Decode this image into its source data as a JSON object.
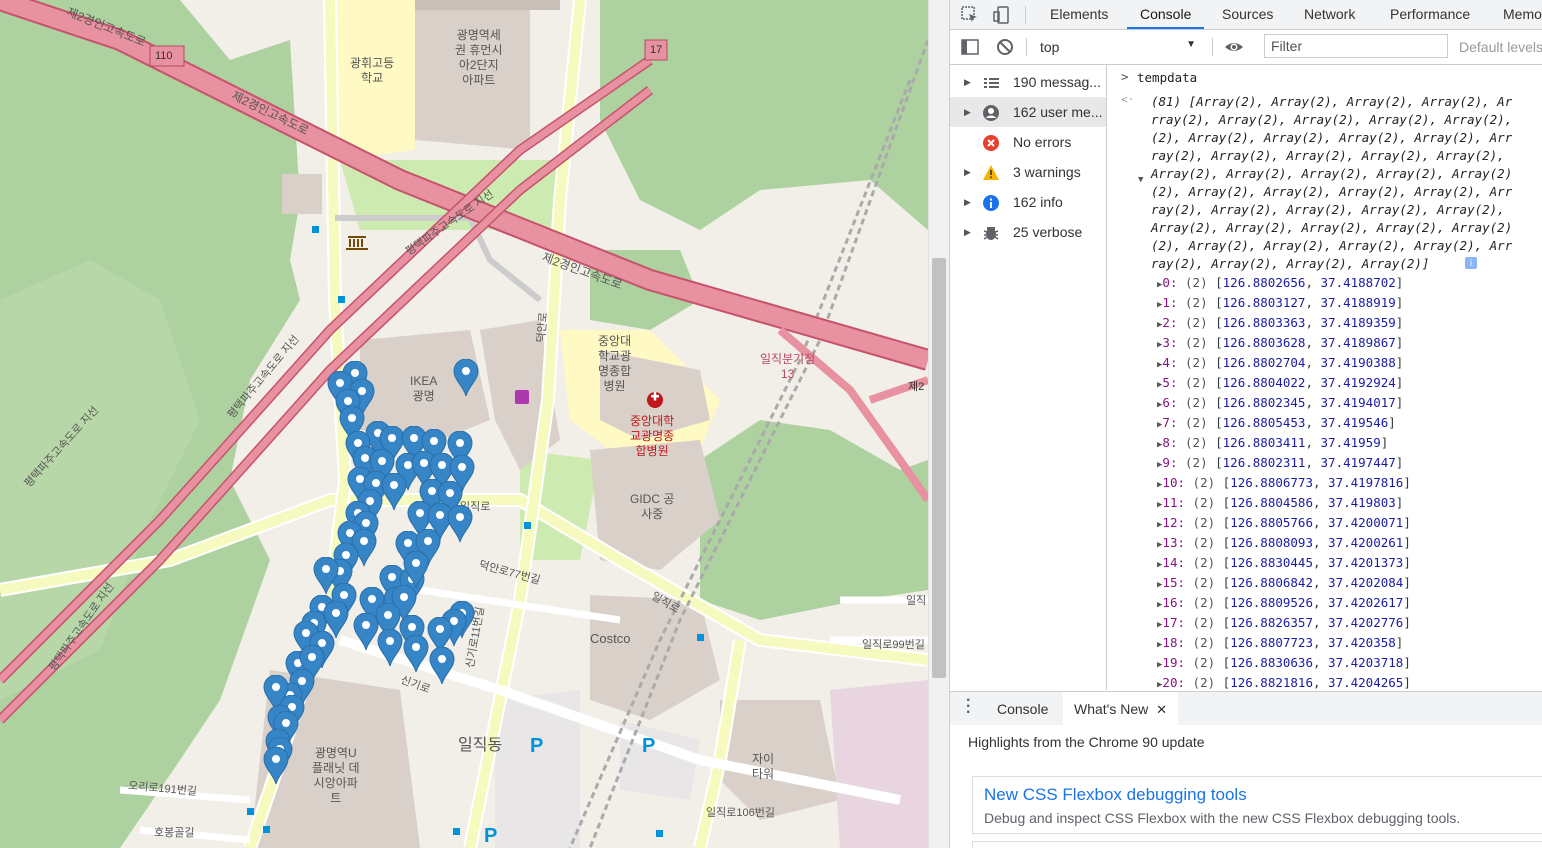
{
  "map": {
    "labels": {
      "school": "광휘고등\n학교",
      "apartment_north": "광명역세\n권 휴먼시\n아2단지\n아파트",
      "ikea": "IKEA\n광명",
      "hospital_name": "중앙대\n학교광\n명종합\n병원",
      "hospital_red": "중앙대학\n교광명종\n합병원",
      "gidc": "GIDC 공\n사중",
      "costco": "Costco",
      "iljik_dong": "일직동",
      "planet_apt": "광명역U\n플래닛 데\n시앙아파\n트",
      "xi_tower": "자이\n타워",
      "expressway_1": "제2경인고속도로",
      "expressway_2": "제2경인고속도로",
      "expressway_3": "제2경인고속도로",
      "branch_1": "평택파주고속도로 지선",
      "branch_2": "평택파주고속도로 지선",
      "branch_3": "평택파주고속도로 지선",
      "branch_4": "평택파주고속도로 지선",
      "junction": "일직분기점\n13",
      "ilijk_ro": "일직로",
      "ilijk_ro_2": "일직로",
      "ilijk_ro_99": "일직로99번길",
      "ilijk_ro_106": "일직로106번길",
      "ilijk_ro_right": "일직",
      "deogan_ro": "덕안로",
      "deogan_ro_77": "덕안로77번길",
      "sinki_ro": "신기로",
      "sinki_ro_11": "신기로11번길",
      "orori_191": "오리로191번길",
      "hobong": "호봉골길",
      "route_110": "110",
      "route_17": "17",
      "right_edge": "제2"
    },
    "marker_color": "#3585c7"
  },
  "devtools": {
    "tabs": [
      "Elements",
      "Console",
      "Sources",
      "Network",
      "Performance",
      "Memo"
    ],
    "active_tab": "Console",
    "context": "top",
    "filter_placeholder": "Filter",
    "level": "Default levels",
    "sidebar": [
      {
        "label": "190 messag...",
        "icon": "list-icon",
        "expandable": true
      },
      {
        "label": "162 user me...",
        "icon": "user-icon",
        "expandable": true
      },
      {
        "label": "No errors",
        "icon": "error-icon",
        "expandable": false
      },
      {
        "label": "3 warnings",
        "icon": "warning-icon",
        "expandable": true
      },
      {
        "label": "162 info",
        "icon": "info-icon",
        "expandable": true
      },
      {
        "label": "25 verbose",
        "icon": "bug-icon",
        "expandable": true
      }
    ],
    "console": {
      "command": "tempdata",
      "summary_lines": [
        "(81) [Array(2), Array(2), Array(2), Array(2), Ar",
        "rray(2), Array(2), Array(2), Array(2), Array(2),",
        "(2), Array(2), Array(2), Array(2), Array(2), Arr",
        "ray(2), Array(2), Array(2), Array(2), Array(2),",
        "Array(2), Array(2), Array(2), Array(2), Array(2)",
        "(2), Array(2), Array(2), Array(2), Array(2), Arr",
        "ray(2), Array(2), Array(2), Array(2), Array(2),",
        "Array(2), Array(2), Array(2), Array(2), Array(2)",
        "(2), Array(2), Array(2), Array(2), Array(2), Arr",
        "ray(2), Array(2), Array(2), Array(2)]"
      ],
      "entries": [
        {
          "idx": "0",
          "a": "126.8802656",
          "b": "37.4188702"
        },
        {
          "idx": "1",
          "a": "126.8803127",
          "b": "37.4188919"
        },
        {
          "idx": "2",
          "a": "126.8803363",
          "b": "37.4189359"
        },
        {
          "idx": "3",
          "a": "126.8803628",
          "b": "37.4189867"
        },
        {
          "idx": "4",
          "a": "126.8802704",
          "b": "37.4190388"
        },
        {
          "idx": "5",
          "a": "126.8804022",
          "b": "37.4192924"
        },
        {
          "idx": "6",
          "a": "126.8802345",
          "b": "37.4194017"
        },
        {
          "idx": "7",
          "a": "126.8805453",
          "b": "37.419546"
        },
        {
          "idx": "8",
          "a": "126.8803411",
          "b": "37.41959"
        },
        {
          "idx": "9",
          "a": "126.8802311",
          "b": "37.4197447"
        },
        {
          "idx": "10",
          "a": "126.8806773",
          "b": "37.4197816"
        },
        {
          "idx": "11",
          "a": "126.8804586",
          "b": "37.419803"
        },
        {
          "idx": "12",
          "a": "126.8805766",
          "b": "37.4200071"
        },
        {
          "idx": "13",
          "a": "126.8808093",
          "b": "37.4200261"
        },
        {
          "idx": "14",
          "a": "126.8830445",
          "b": "37.4201373"
        },
        {
          "idx": "15",
          "a": "126.8806842",
          "b": "37.4202084"
        },
        {
          "idx": "16",
          "a": "126.8809526",
          "b": "37.4202617"
        },
        {
          "idx": "17",
          "a": "126.8826357",
          "b": "37.4202776"
        },
        {
          "idx": "18",
          "a": "126.8807723",
          "b": "37.420358"
        },
        {
          "idx": "19",
          "a": "126.8830636",
          "b": "37.4203718"
        },
        {
          "idx": "20",
          "a": "126.8821816",
          "b": "37.4204265"
        }
      ]
    },
    "drawer": {
      "tabs": [
        "Console",
        "What's New"
      ],
      "active": "What's New",
      "highlights": "Highlights from the Chrome 90 update",
      "news_title": "New CSS Flexbox debugging tools",
      "news_desc": "Debug and inspect CSS Flexbox with the new CSS Flexbox debugging tools."
    }
  }
}
